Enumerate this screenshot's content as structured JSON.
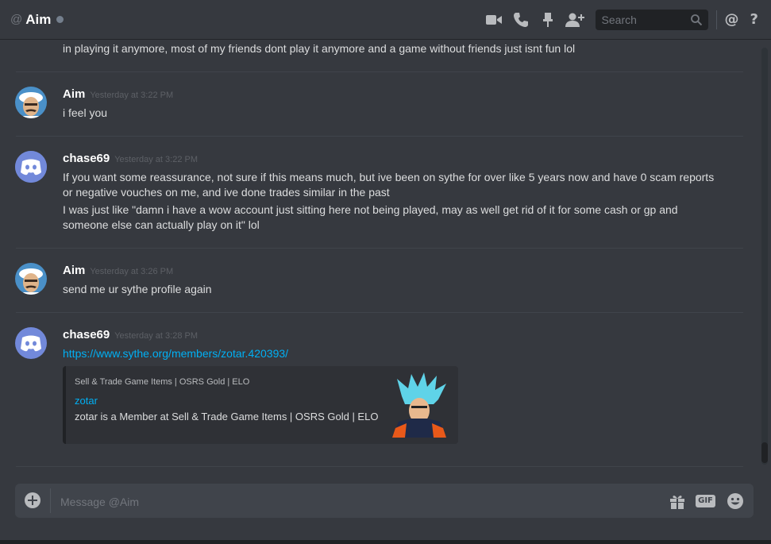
{
  "header": {
    "at_symbol": "@",
    "name": "Aim",
    "search_placeholder": "Search",
    "mention_icon_label": "@",
    "help_icon_label": "?"
  },
  "messages": [
    {
      "continued_text": "in playing it anymore, most of my friends dont play it anymore and a game without friends just isnt fun lol"
    },
    {
      "author": "Aim",
      "timestamp": "Yesterday at 3:22 PM",
      "lines": [
        "i feel you"
      ]
    },
    {
      "author": "chase69",
      "timestamp": "Yesterday at 3:22 PM",
      "lines": [
        "If you want some reassurance, not sure if this means much, but ive been on sythe for over like 5 years now and have 0 scam reports",
        "or negative vouches on me, and ive done trades similar in the past",
        "I was just like \"damn i have a wow account just sitting here not being played, may as well get rid of it for some cash or gp and",
        "someone else can actually play on it\" lol"
      ]
    },
    {
      "author": "Aim",
      "timestamp": "Yesterday at 3:26 PM",
      "lines": [
        "send me ur sythe profile again"
      ]
    },
    {
      "author": "chase69",
      "timestamp": "Yesterday at 3:28 PM",
      "link": "https://www.sythe.org/members/zotar.420393/",
      "embed": {
        "provider": "Sell & Trade Game Items | OSRS Gold | ELO",
        "title": "zotar",
        "description": "zotar is a Member at Sell & Trade Game Items | OSRS Gold | ELO"
      }
    }
  ],
  "composer": {
    "placeholder": "Message @Aim",
    "gif_label": "GIF"
  },
  "colors": {
    "background": "#36393f",
    "link": "#00b0f4",
    "discord_blurple": "#7289da"
  }
}
